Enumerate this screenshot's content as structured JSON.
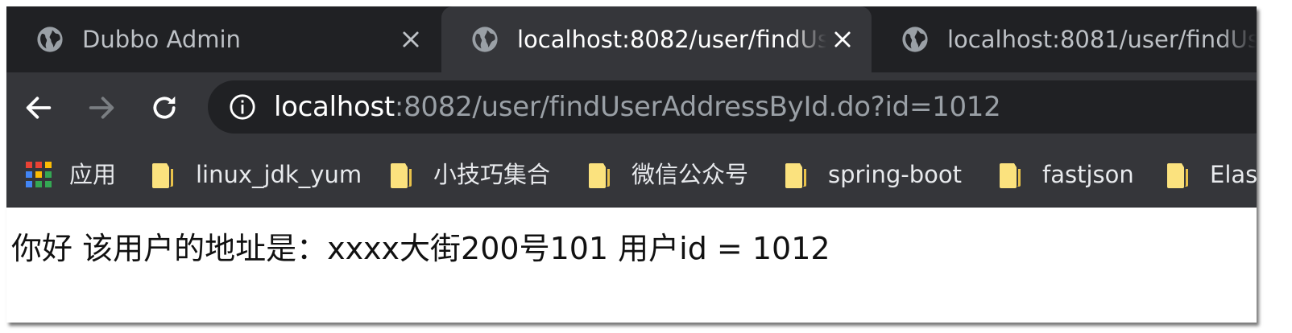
{
  "tabs": [
    {
      "title": "Dubbo Admin",
      "icon": "globe-icon"
    },
    {
      "title": "localhost:8082/user/findUs",
      "icon": "globe-icon",
      "active": true
    },
    {
      "title": "localhost:8081/user/findUs",
      "icon": "globe-icon"
    }
  ],
  "toolbar": {
    "back_icon": "back-arrow-icon",
    "forward_icon": "forward-arrow-icon",
    "reload_icon": "reload-icon",
    "url_host": "localhost",
    "url_rest": ":8082/user/findUserAddressById.do?id=1012"
  },
  "bookmarks": [
    {
      "label": "应用",
      "icon": "apps-grid-icon"
    },
    {
      "label": "linux_jdk_yum",
      "icon": "folder-icon"
    },
    {
      "label": "小技巧集合",
      "icon": "folder-icon"
    },
    {
      "label": "微信公众号",
      "icon": "folder-icon"
    },
    {
      "label": "spring-boot",
      "icon": "folder-icon"
    },
    {
      "label": "fastjson",
      "icon": "folder-icon"
    },
    {
      "label": "Elast",
      "icon": "folder-icon"
    }
  ],
  "page": {
    "body_text": "你好 该用户的地址是：xxxx大街200号101 用户id = 1012"
  },
  "colors": {
    "tabstrip_bg": "#202124",
    "toolbar_bg": "#35363a",
    "omnibox_bg": "#202124",
    "folder_yellow": "#fbe27e"
  }
}
